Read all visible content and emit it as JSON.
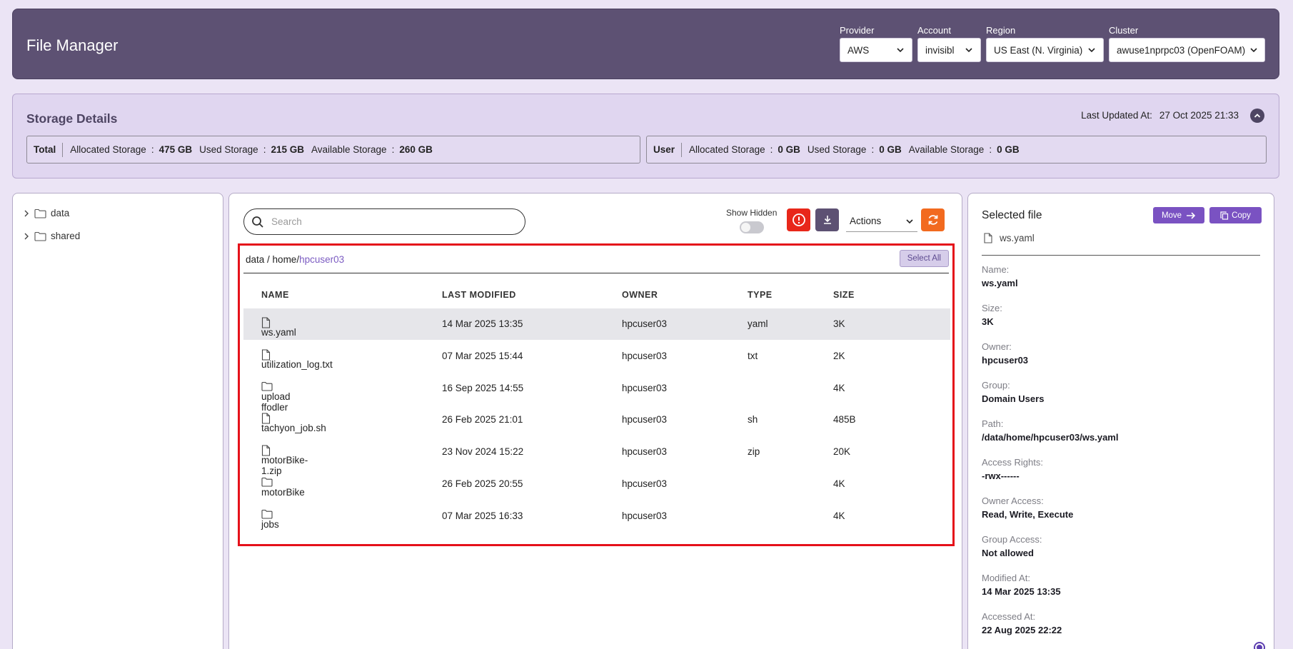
{
  "header": {
    "title": "File Manager",
    "provider": {
      "label": "Provider",
      "value": "AWS"
    },
    "account": {
      "label": "Account",
      "value": "invisibl"
    },
    "region": {
      "label": "Region",
      "value": "US East (N. Virginia)"
    },
    "cluster": {
      "label": "Cluster",
      "value": "awuse1nprpc03 (OpenFOAM)"
    }
  },
  "storage": {
    "title": "Storage Details",
    "last_updated_label": "Last Updated At:",
    "last_updated_value": "27 Oct 2025 21:33",
    "total": {
      "tag": "Total",
      "allocated_label": "Allocated Storage",
      "allocated_value": "475 GB",
      "used_label": "Used Storage",
      "used_value": "215 GB",
      "available_label": "Available Storage",
      "available_value": "260 GB"
    },
    "user": {
      "tag": "User",
      "allocated_label": "Allocated Storage",
      "allocated_value": "0 GB",
      "used_label": "Used Storage",
      "used_value": "0 GB",
      "available_label": "Available Storage",
      "available_value": "0 GB"
    },
    "separator": ":"
  },
  "tree": {
    "items": [
      {
        "label": "data"
      },
      {
        "label": "shared"
      }
    ]
  },
  "toolbar": {
    "search_placeholder": "Search",
    "show_hidden_label": "Show Hidden",
    "actions_label": "Actions"
  },
  "breadcrumb": {
    "part1": "data",
    "sep1": " / ",
    "part2": "home/",
    "current": "hpcuser03"
  },
  "select_all_label": "Select All",
  "table": {
    "headers": [
      "NAME",
      "LAST MODIFIED",
      "OWNER",
      "TYPE",
      "SIZE"
    ],
    "rows": [
      {
        "icon": "file-icon",
        "name": "ws.yaml",
        "modified": "14 Mar 2025 13:35",
        "owner": "hpcuser03",
        "type": "yaml",
        "size": "3K"
      },
      {
        "icon": "file-icon",
        "name": "utilization_log.txt",
        "modified": "07 Mar 2025 15:44",
        "owner": "hpcuser03",
        "type": "txt",
        "size": "2K"
      },
      {
        "icon": "folder-icon",
        "name": "upload ffodler",
        "modified": "16 Sep 2025 14:55",
        "owner": "hpcuser03",
        "type": "",
        "size": "4K"
      },
      {
        "icon": "file-icon",
        "name": "tachyon_job.sh",
        "modified": "26 Feb 2025 21:01",
        "owner": "hpcuser03",
        "type": "sh",
        "size": "485B"
      },
      {
        "icon": "file-icon",
        "name": "motorBike-1.zip",
        "modified": "23 Nov 2024 15:22",
        "owner": "hpcuser03",
        "type": "zip",
        "size": "20K"
      },
      {
        "icon": "folder-icon",
        "name": "motorBike",
        "modified": "26 Feb 2025 20:55",
        "owner": "hpcuser03",
        "type": "",
        "size": "4K"
      },
      {
        "icon": "folder-icon",
        "name": "jobs",
        "modified": "07 Mar 2025 16:33",
        "owner": "hpcuser03",
        "type": "",
        "size": "4K"
      }
    ]
  },
  "details": {
    "title": "Selected file",
    "move_label": "Move",
    "copy_label": "Copy",
    "file_name": "ws.yaml",
    "props": [
      {
        "key": "Name:",
        "value": "ws.yaml"
      },
      {
        "key": "Size:",
        "value": "3K"
      },
      {
        "key": "Owner:",
        "value": "hpcuser03"
      },
      {
        "key": "Group:",
        "value": "Domain Users"
      },
      {
        "key": "Path:",
        "value": "/data/home/hpcuser03/ws.yaml"
      },
      {
        "key": "Access Rights:",
        "value": "-rwx------"
      },
      {
        "key": "Owner Access:",
        "value": "Read, Write, Execute"
      },
      {
        "key": "Group Access:",
        "value": "Not allowed"
      },
      {
        "key": "Modified At:",
        "value": "14 Mar 2025 13:35"
      },
      {
        "key": "Accessed At:",
        "value": "22 Aug 2025 22:22"
      }
    ]
  },
  "colors": {
    "header_bg": "#5d5173",
    "page_bg": "#ebe4f5",
    "accent": "#7a52c2",
    "highlight_border": "#e5111a",
    "warn": "#e8271a",
    "refresh": "#f26a1f"
  }
}
